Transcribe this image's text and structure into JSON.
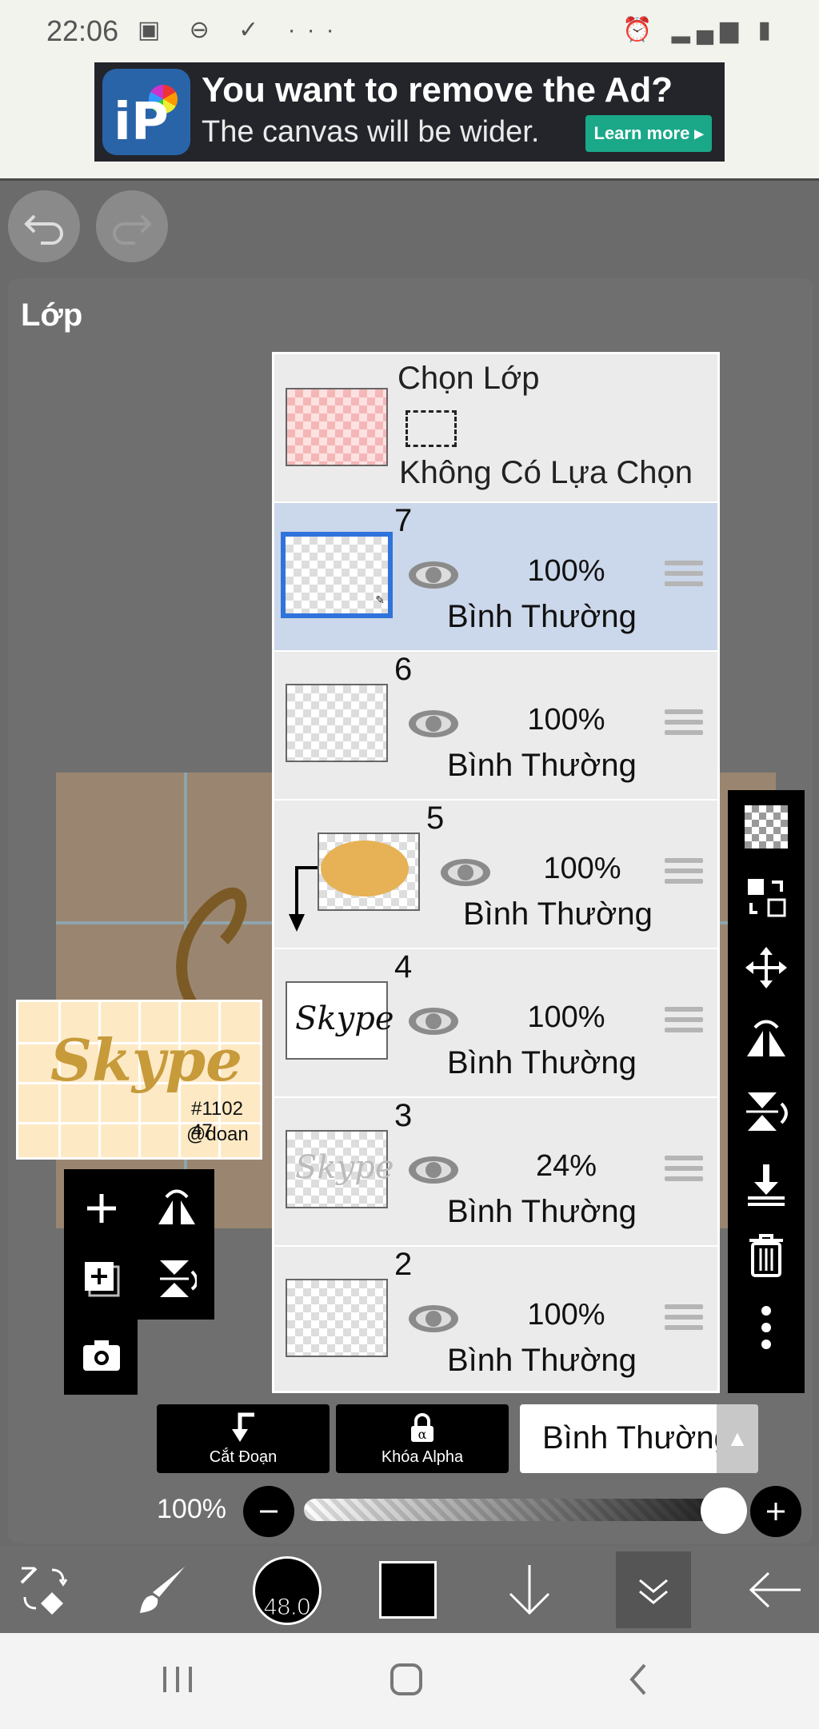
{
  "status_bar": {
    "time": "22:06",
    "left_icons": "▣ ⊖ ✓ ···",
    "right_icons": "⏰ ▂▄▆ ▮"
  },
  "ad": {
    "logo_text": "iP",
    "headline": "You want to remove the Ad?",
    "subline": "The canvas will be wider.",
    "cta": "Learn more ▸"
  },
  "panel": {
    "title": "Lớp"
  },
  "preview": {
    "art_text": "Skype",
    "tag1": "#1102 47",
    "tag2": "@doan"
  },
  "selection_layer": {
    "title": "Chọn Lớp",
    "status": "Không Có Lựa Chọn"
  },
  "layers": [
    {
      "number": "7",
      "opacity": "100%",
      "mode": "Bình Thường",
      "selected": true
    },
    {
      "number": "6",
      "opacity": "100%",
      "mode": "Bình Thường",
      "selected": false
    },
    {
      "number": "5",
      "opacity": "100%",
      "mode": "Bình Thường",
      "selected": false,
      "clipped": true
    },
    {
      "number": "4",
      "opacity": "100%",
      "mode": "Bình Thường",
      "selected": false,
      "thumb_text": "Skype"
    },
    {
      "number": "3",
      "opacity": "24%",
      "mode": "Bình Thường",
      "selected": false,
      "thumb_text": "Skype"
    },
    {
      "number": "2",
      "opacity": "100%",
      "mode": "Bình Thường",
      "selected": false
    }
  ],
  "controls": {
    "clip_label": "Cắt Đoạn",
    "alpha_lock_label": "Khóa Alpha",
    "blend_mode": "Bình Thường",
    "opacity_label": "100%"
  },
  "toolbar": {
    "brush_size": "48.0",
    "current_color": "#000000"
  },
  "icons": {
    "undo": "undo-icon",
    "redo": "redo-icon",
    "eye": "eye-icon",
    "add_layer": "plus-icon",
    "flip_h": "flip-horizontal-icon",
    "flip_v": "flip-vertical-icon",
    "camera": "camera-icon",
    "trash": "trash-icon",
    "more": "more-vertical-icon"
  }
}
